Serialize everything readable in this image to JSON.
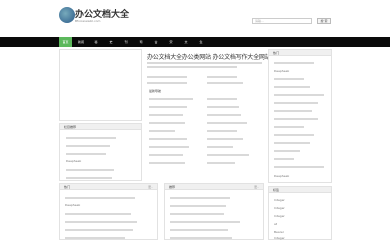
{
  "site": {
    "title": "办公文档大全",
    "url": "Bfoiceiaiaikl.com"
  },
  "search": {
    "placeholder": "请输...",
    "button": "搜 索"
  },
  "nav": {
    "items": [
      "首页",
      "新闻",
      "秘",
      "史",
      "刊",
      "司",
      "古",
      "宋",
      "文",
      "生"
    ]
  },
  "article": {
    "title": "办公文档大全办公类网站 办公文档写作大全网站",
    "subtitle": "公文精选 (文件写作素材)",
    "section": "最新导航"
  },
  "left": {
    "recent_header": "栏目推荐",
    "bottom1_header": "热门",
    "bottom1_more": "更..",
    "bottom2_header": "推荐",
    "bottom2_more": "更.."
  },
  "right": {
    "top_header": "热门",
    "bottom_header": "标签",
    "keyword": "DeepSeek",
    "tags": [
      "Integer",
      "Integer",
      "Integer",
      "at",
      "Bearer",
      "Integer"
    ]
  }
}
